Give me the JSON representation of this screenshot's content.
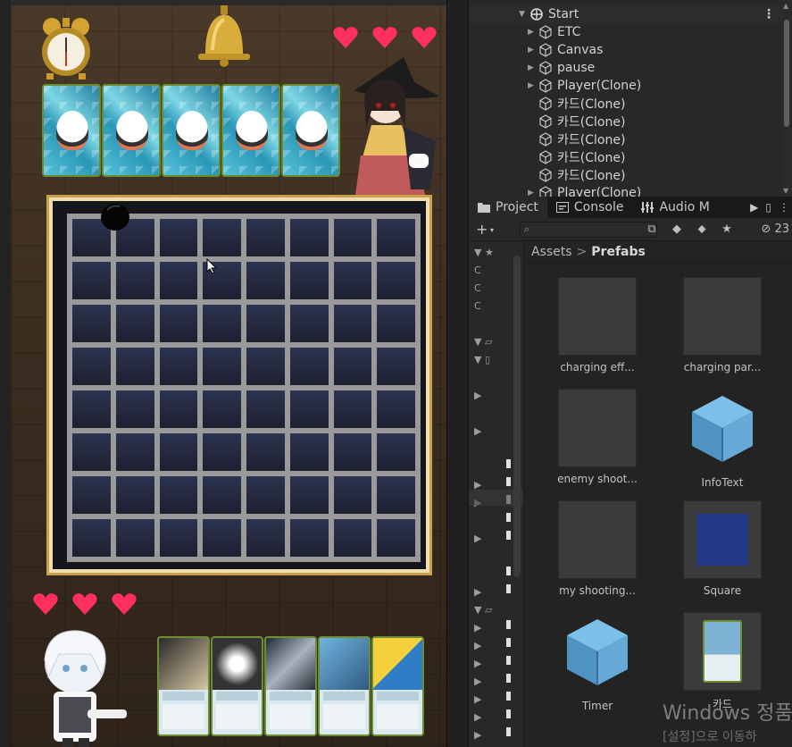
{
  "hierarchy": {
    "items": [
      {
        "label": "Start",
        "selected": true
      },
      {
        "label": "ETC"
      },
      {
        "label": "Canvas"
      },
      {
        "label": "pause"
      },
      {
        "label": "Player(Clone)"
      },
      {
        "label": "카드(Clone)"
      },
      {
        "label": "카드(Clone)"
      },
      {
        "label": "카드(Clone)"
      },
      {
        "label": "카드(Clone)"
      },
      {
        "label": "카드(Clone)"
      },
      {
        "label": "Player(Clone)"
      }
    ],
    "menu_icon": "kebab-icon"
  },
  "project": {
    "tabs": [
      {
        "label": "Project",
        "active": true
      },
      {
        "label": "Console"
      },
      {
        "label": "Audio M"
      }
    ],
    "hidden_count": "23",
    "breadcrumb": {
      "root": "Assets",
      "current": "Prefabs"
    },
    "assets": [
      {
        "label": "charging eff...",
        "kind": "gray"
      },
      {
        "label": "charging par...",
        "kind": "gray"
      },
      {
        "label": "enemy shoot...",
        "kind": "gray"
      },
      {
        "label": "InfoText",
        "kind": "cube"
      },
      {
        "label": "my shooting...",
        "kind": "gray"
      },
      {
        "label": "Square",
        "kind": "square"
      },
      {
        "label": "Timer",
        "kind": "cube"
      },
      {
        "label": "카드",
        "kind": "card"
      }
    ]
  },
  "game": {
    "enemy_hearts": 3,
    "player_hearts": 3,
    "enemy_hand_cards": 5,
    "player_hand_cards": 5,
    "board_size": 8
  },
  "watermark": {
    "line1": "Windows 정품",
    "line2": "[설정]으로 이동하"
  },
  "colors": {
    "editor_bg": "#232323",
    "panel_bg": "#282828",
    "heart": "#ff2f5e",
    "cube": "#66a9d6",
    "board_frame": "#c8a24a"
  }
}
